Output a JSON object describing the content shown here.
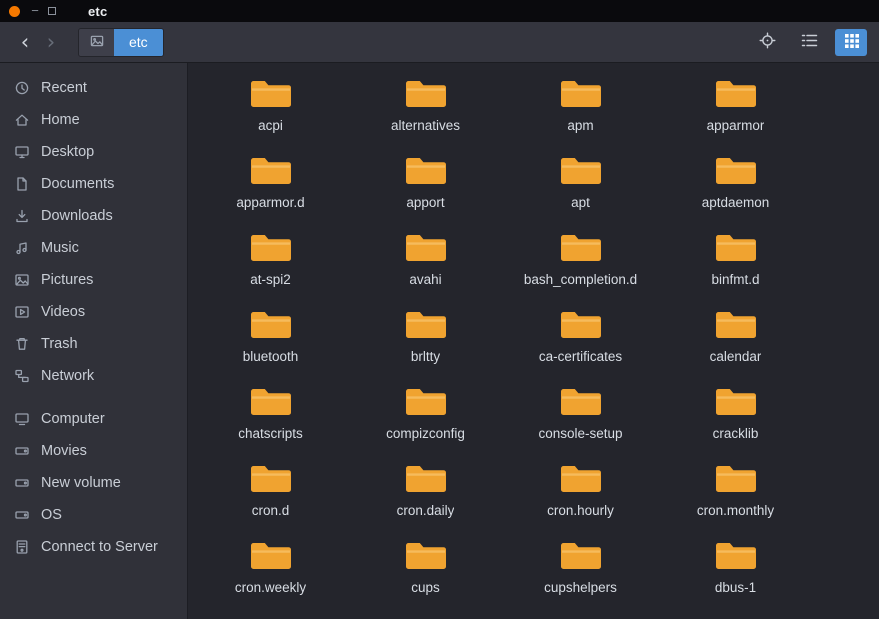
{
  "window": {
    "title": "etc"
  },
  "titlebar": {
    "controls": [
      {
        "name": "close"
      },
      {
        "name": "minimize"
      },
      {
        "name": "maximize"
      }
    ]
  },
  "toolbar": {
    "back_icon": "‹",
    "forward_icon": "›",
    "pathbar": {
      "root_icon": "image-icon",
      "current_label": "etc"
    },
    "actions": [
      {
        "icon": "search-icon",
        "active": false
      },
      {
        "icon": "list-view-icon",
        "active": false
      },
      {
        "icon": "grid-view-icon",
        "active": true
      }
    ]
  },
  "sidebar": {
    "sections": [
      {
        "items": [
          {
            "label": "Recent",
            "icon": "recent-icon"
          },
          {
            "label": "Home",
            "icon": "home-icon"
          },
          {
            "label": "Desktop",
            "icon": "desktop-icon"
          },
          {
            "label": "Documents",
            "icon": "documents-icon"
          },
          {
            "label": "Downloads",
            "icon": "downloads-icon"
          },
          {
            "label": "Music",
            "icon": "music-icon"
          },
          {
            "label": "Pictures",
            "icon": "pictures-icon"
          },
          {
            "label": "Videos",
            "icon": "videos-icon"
          },
          {
            "label": "Trash",
            "icon": "trash-icon"
          },
          {
            "label": "Network",
            "icon": "network-icon"
          }
        ]
      },
      {
        "items": [
          {
            "label": "Computer",
            "icon": "computer-icon"
          },
          {
            "label": "Movies",
            "icon": "drive-icon"
          },
          {
            "label": "New volume",
            "icon": "drive-icon"
          },
          {
            "label": "OS",
            "icon": "drive-icon"
          },
          {
            "label": "Connect to Server",
            "icon": "server-icon"
          }
        ]
      }
    ]
  },
  "content": {
    "folders": [
      "acpi",
      "alternatives",
      "apm",
      "apparmor",
      "apparmor.d",
      "apport",
      "apt",
      "aptdaemon",
      "at-spi2",
      "avahi",
      "bash_completion.d",
      "binfmt.d",
      "bluetooth",
      "brltty",
      "ca-certificates",
      "calendar",
      "chatscripts",
      "compizconfig",
      "console-setup",
      "cracklib",
      "cron.d",
      "cron.daily",
      "cron.hourly",
      "cron.monthly",
      "cron.weekly",
      "cups",
      "cupshelpers",
      "dbus-1"
    ]
  },
  "colors": {
    "accent": "#4b8fd5",
    "folder": "#f0a330",
    "folder_stripe": "#f6bb5c"
  }
}
